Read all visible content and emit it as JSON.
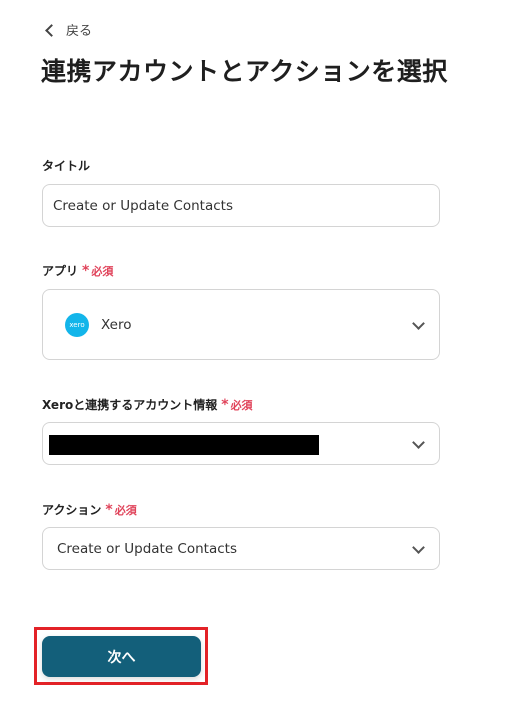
{
  "header": {
    "back_label": "戻る",
    "title": "連携アカウントとアクションを選択"
  },
  "form": {
    "title_field": {
      "label": "タイトル",
      "value": "Create or Update Contacts"
    },
    "app_field": {
      "label": "アプリ",
      "required_label": "必須",
      "value": "Xero",
      "logo_text": "xero",
      "logo_color": "#13b5ea"
    },
    "account_field": {
      "label": "Xeroと連携するアカウント情報",
      "required_label": "必須"
    },
    "action_field": {
      "label": "アクション",
      "required_label": "必須",
      "value": "Create or Update Contacts"
    }
  },
  "footer": {
    "next_label": "次へ",
    "next_color": "#135f7a",
    "highlight_color": "#e32227"
  },
  "colors": {
    "required": "#e0435a"
  }
}
